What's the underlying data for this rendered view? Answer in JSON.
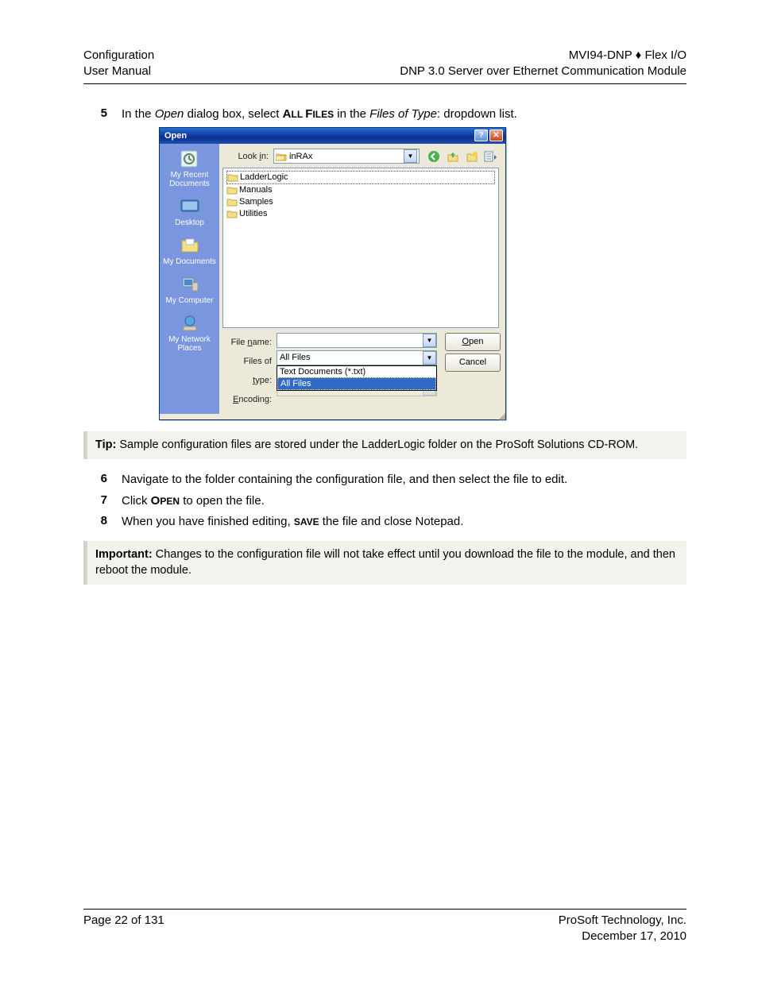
{
  "header": {
    "left1": "Configuration",
    "left2": "User Manual",
    "right1": "MVI94-DNP ♦ Flex I/O",
    "right2": "DNP 3.0 Server over Ethernet Communication Module"
  },
  "steps": {
    "s5": {
      "num": "5",
      "pre": "In the ",
      "open": "Open",
      "mid": " dialog box, select ",
      "allfiles_pre": "A",
      "allfiles_rest": "LL ",
      "files_pre": "F",
      "files_rest": "ILES",
      "mid2": " in the ",
      "fot": "Files of Type",
      "post": ": dropdown list."
    },
    "s6": {
      "num": "6",
      "text": "Navigate to the folder containing the configuration file, and then select the file to edit."
    },
    "s7": {
      "num": "7",
      "pre": "Click ",
      "open_pre": "O",
      "open_rest": "PEN",
      "post": " to open the file."
    },
    "s8": {
      "num": "8",
      "pre": "When you have finished editing, ",
      "save_pre": "S",
      "save_rest": "AVE",
      "post": " the file and close Notepad."
    }
  },
  "tip": {
    "label": "Tip:",
    "text": " Sample configuration files are stored under the LadderLogic folder on the ProSoft Solutions CD-ROM."
  },
  "important": {
    "label": "Important:",
    "text": " Changes to the configuration file will not take effect until you download the file to the module, and then reboot the module."
  },
  "dialog": {
    "title": "Open",
    "lookin_label": "Look in:",
    "lookin_u": "i",
    "lookin_value": "inRAx",
    "places": {
      "recent": "My Recent Documents",
      "desktop": "Desktop",
      "mydocs": "My Documents",
      "mycomp": "My Computer",
      "mynet": "My Network Places"
    },
    "folders": [
      "LadderLogic",
      "Manuals",
      "Samples",
      "Utilities"
    ],
    "labels": {
      "filename": "File name:",
      "filename_u": "n",
      "filesoftype": "Files of type:",
      "filesoftype_u": "t",
      "encoding": "Encoding:",
      "encoding_u": "E"
    },
    "filesoftype_value": "All Files",
    "options": {
      "opt1": "Text Documents (*.txt)",
      "opt2": "All Files"
    },
    "buttons": {
      "open": "Open",
      "open_u": "O",
      "cancel": "Cancel"
    }
  },
  "footer": {
    "page": "Page 22 of 131",
    "company": "ProSoft Technology, Inc.",
    "date": "December 17, 2010"
  }
}
